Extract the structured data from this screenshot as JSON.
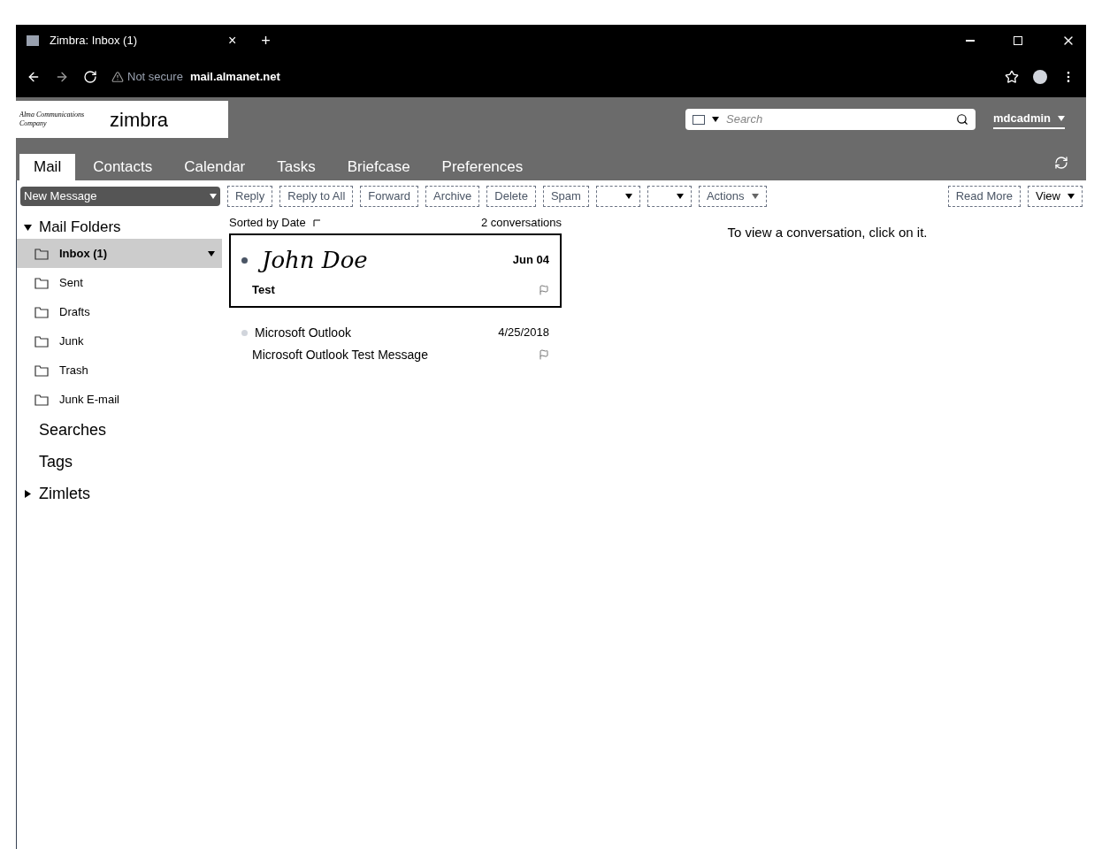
{
  "browser": {
    "tab_title": "Zimbra: Inbox (1)",
    "tab_close": "×",
    "new_tab": "+",
    "security": "Not secure",
    "url": "mail.almanet.net"
  },
  "header": {
    "company_logo": "Alma Communications Company",
    "logo_text": "zimbra",
    "search": {
      "placeholder": "Search"
    },
    "user": "mdcadmin"
  },
  "apps": [
    {
      "label": "Mail",
      "selected": true
    },
    {
      "label": "Contacts",
      "selected": false
    },
    {
      "label": "Calendar",
      "selected": false
    },
    {
      "label": "Tasks",
      "selected": false
    },
    {
      "label": "Briefcase",
      "selected": false
    },
    {
      "label": "Preferences",
      "selected": false
    }
  ],
  "toolbar": {
    "new_message": "New Message",
    "buttons": [
      "Reply",
      "Reply to All",
      "Forward",
      "Archive",
      "Delete",
      "Spam"
    ],
    "actions": "Actions",
    "read_more": "Read More",
    "view": "View"
  },
  "sidebar": {
    "title": "Mail Folders",
    "expanded": true,
    "folders": [
      {
        "name": "Inbox (1)",
        "selected": true,
        "unread": true
      },
      {
        "name": "Sent",
        "selected": false,
        "unread": false
      },
      {
        "name": "Drafts",
        "selected": false,
        "unread": false
      },
      {
        "name": "Junk",
        "selected": false,
        "unread": false
      },
      {
        "name": "Trash",
        "selected": false,
        "unread": false
      },
      {
        "name": "Junk E-mail",
        "selected": false,
        "unread": false
      }
    ],
    "sections": [
      {
        "label": "Searches",
        "expandable": false
      },
      {
        "label": "Tags",
        "expandable": false
      },
      {
        "label": "Zimlets",
        "expandable": true
      }
    ]
  },
  "list": {
    "sort": "Sorted by Date",
    "count": "2 conversations",
    "messages": [
      {
        "sender": "John Doe",
        "handwritten": true,
        "date": "Jun 04",
        "subject": "Test",
        "selected": true,
        "unread": true
      },
      {
        "sender": "Microsoft Outlook",
        "handwritten": false,
        "date": "4/25/2018",
        "subject": "Microsoft Outlook Test Message",
        "selected": false,
        "unread": false
      }
    ]
  },
  "reading_pane": {
    "hint": "To view a conversation, click on it."
  }
}
